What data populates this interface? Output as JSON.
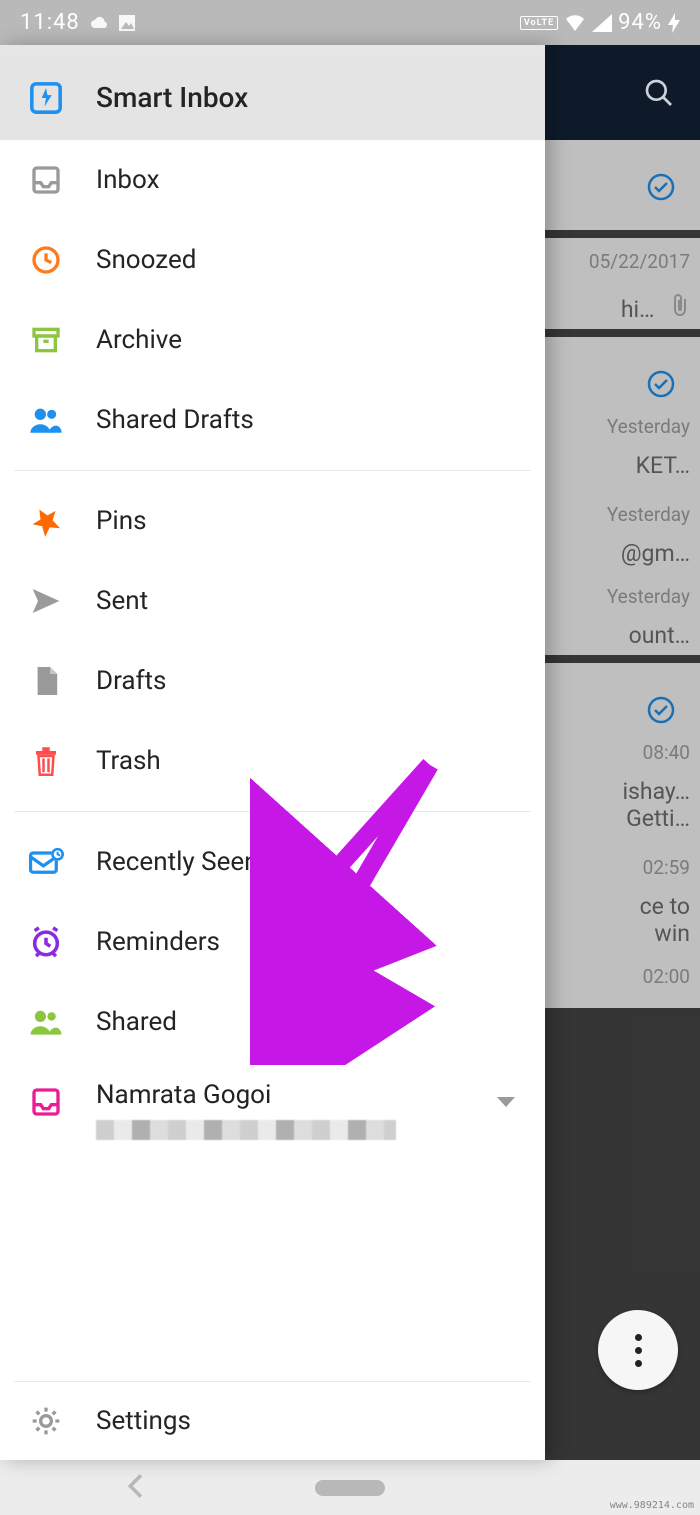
{
  "statusbar": {
    "time": "11:48",
    "battery": "94%"
  },
  "drawer": {
    "selected": "Smart Inbox",
    "items": [
      {
        "id": "smart-inbox",
        "label": "Smart Inbox"
      },
      {
        "id": "inbox",
        "label": "Inbox"
      },
      {
        "id": "snoozed",
        "label": "Snoozed"
      },
      {
        "id": "archive",
        "label": "Archive"
      },
      {
        "id": "shared-drafts",
        "label": "Shared Drafts"
      }
    ],
    "items2": [
      {
        "id": "pins",
        "label": "Pins"
      },
      {
        "id": "sent",
        "label": "Sent"
      },
      {
        "id": "drafts",
        "label": "Drafts"
      },
      {
        "id": "trash",
        "label": "Trash"
      }
    ],
    "items3": [
      {
        "id": "recently-seen",
        "label": "Recently Seen"
      },
      {
        "id": "reminders",
        "label": "Reminders"
      },
      {
        "id": "shared",
        "label": "Shared"
      }
    ],
    "account": {
      "name": "Namrata Gogoi"
    },
    "settings_label": "Settings"
  },
  "background": {
    "rows": [
      {
        "date": "05/22/2017",
        "snippet": "hi…",
        "has_attachment": true,
        "has_check": true
      },
      {
        "date": "Yesterday",
        "snippet": "KET…",
        "has_check": true
      },
      {
        "date": "Yesterday",
        "snippet": "@gm…"
      },
      {
        "date": "Yesterday",
        "snippet": "ount…"
      },
      {
        "date": "08:40",
        "snippet": "ishay…",
        "snippet2": "Getti…",
        "has_check": true
      },
      {
        "date": "02:59",
        "snippet": "ce to",
        "snippet2": "win"
      },
      {
        "date": "02:00",
        "snippet": ""
      }
    ]
  },
  "watermark": "www.989214.com"
}
